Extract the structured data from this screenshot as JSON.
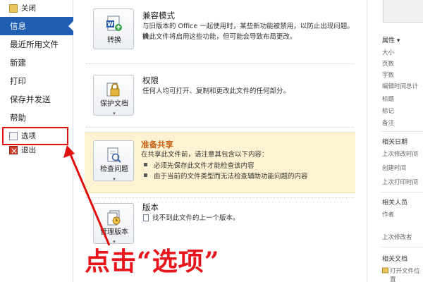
{
  "nav": {
    "close": "关闭",
    "info": "信息",
    "recent": "最近所用文件",
    "new": "新建",
    "print": "打印",
    "save_send": "保存并发送",
    "help": "帮助",
    "options": "选项",
    "exit": "退出"
  },
  "sections": {
    "compat": {
      "button": "转换",
      "title": "兼容模式",
      "desc1": "与旧版本的 Office 一起使用时，某些新功能被禁用，以防止出现问题。转",
      "desc2": "换此文件将启用这些功能，但可能会导致布局更改。"
    },
    "permissions": {
      "button": "保护文档",
      "title": "权限",
      "desc": "任何人均可打开、复制和更改此文件的任何部分。"
    },
    "prepare": {
      "button": "检查问题",
      "title": "准备共享",
      "desc": "在共享此文件前，请注意其包含以下内容：",
      "bullets": [
        "必须先保存此文件才能检查该内容",
        "由于当前的文件类型而无法检查辅助功能问题的内容"
      ]
    },
    "versions": {
      "button": "管理版本",
      "title": "版本",
      "desc": "找不到此文件的上一个版本。"
    }
  },
  "right_panel": {
    "properties_header": "属性 ▾",
    "props": [
      "大小",
      "页数",
      "字数",
      "编辑时间总计",
      "标题",
      "标记",
      "备注"
    ],
    "dates_header": "相关日期",
    "dates": [
      "上次修改时间",
      "创建时间",
      "上次打印时间"
    ],
    "people_header": "相关人员",
    "people": [
      "作者",
      "上次修改者"
    ],
    "docs_header": "相关文档",
    "docs": [
      "打开文件位置"
    ]
  },
  "annotation": {
    "text": "点击“选项”",
    "color": "#e8141c"
  },
  "colors": {
    "nav_active": "#1e5fb3",
    "highlight_bg": "#fdf3d2",
    "orange_title": "#c8641b"
  }
}
